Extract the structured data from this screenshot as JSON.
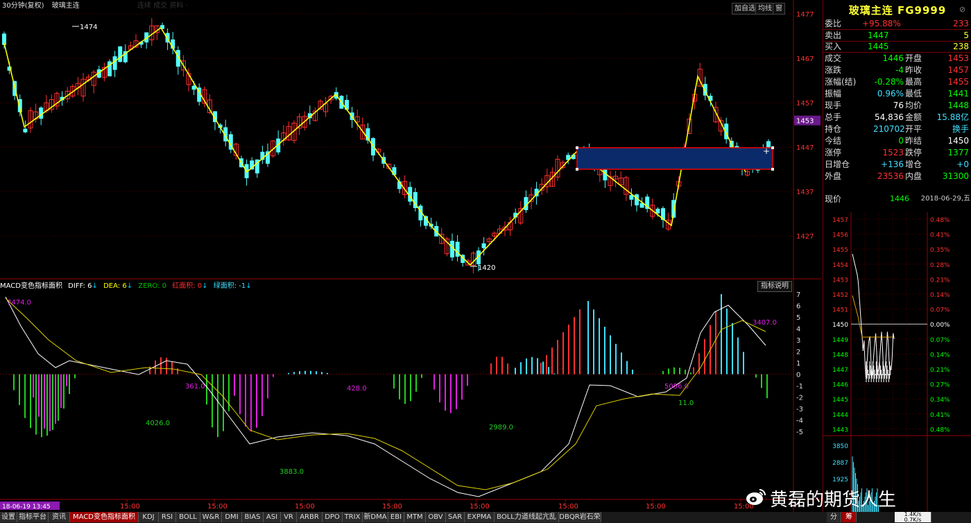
{
  "app": {
    "header_left": "30分钟(复权)",
    "header_name": "玻璃主连",
    "header_faded": "连续 成交 资料 ·"
  },
  "toolbar": {
    "add_watch": "加自选",
    "avg_line": "均线",
    "window": "窗"
  },
  "price_axis": {
    "ticks": [
      "1477",
      "1467",
      "1457",
      "1447",
      "1437",
      "1427"
    ],
    "current_marker": "1453"
  },
  "macd_axis": {
    "ticks": [
      "7",
      "6",
      "5",
      "4",
      "3",
      "2",
      "1",
      "0",
      "-1",
      "-2",
      "-3",
      "-4",
      "-5"
    ]
  },
  "time_axis": {
    "start_label": "18-06-19 13:45",
    "labels": [
      "15:00",
      "15:00",
      "15:00",
      "15:00",
      "15:00",
      "15:00",
      "15:00",
      "15:00"
    ]
  },
  "annotations": {
    "high": "1474",
    "low": "1420"
  },
  "macd": {
    "name": "MACD变色指标面积",
    "diff_label": "DIFF:",
    "diff_value": "6",
    "dea_label": "DEA:",
    "dea_value": "6",
    "zero_label": "ZERO:",
    "zero_value": "0",
    "red_label": "红面积:",
    "red_value": "0",
    "green_label": "绿面积:",
    "green_value": "-1",
    "explain": "指标说明",
    "area_labels": [
      "7474.0",
      "4026.0",
      "361.0",
      "3883.0",
      "428.0",
      "2989.0",
      "5056.0",
      "11.0",
      "3407.0"
    ]
  },
  "quote": {
    "title": "玻璃主连 FG9999",
    "weibi_label": "委比",
    "weibi_pct": "+95.88%",
    "weibi_val": "233",
    "sell_label": "卖出",
    "sell_price": "1447",
    "sell_vol": "5",
    "buy_label": "买入",
    "buy_price": "1445",
    "buy_vol": "238",
    "rows": [
      {
        "l1": "成交",
        "v1": "1446",
        "l2": "开盘",
        "v2": "1453",
        "c1": "#00ff00",
        "c2": "#ff3030"
      },
      {
        "l1": "涨跌",
        "v1": "-4",
        "l2": "昨收",
        "v2": "1457",
        "c1": "#00ff00",
        "c2": "#ff3030"
      },
      {
        "l1": "涨幅(结)",
        "v1": "-0.28%",
        "l2": "最高",
        "v2": "1455",
        "c1": "#00ff00",
        "c2": "#ff3030"
      },
      {
        "l1": "振幅",
        "v1": "0.96%",
        "l2": "最低",
        "v2": "1441",
        "c1": "#40e0ff",
        "c2": "#00ff00"
      },
      {
        "l1": "现手",
        "v1": "76",
        "l2": "均价",
        "v2": "1448",
        "c1": "#ffffff",
        "c2": "#00ff00"
      },
      {
        "l1": "总手",
        "v1": "54,836",
        "l2": "金额",
        "v2": "15.88亿",
        "c1": "#ffffff",
        "c2": "#40e0ff"
      },
      {
        "l1": "持仓",
        "v1": "210702",
        "l2": "开平",
        "v2": "换手",
        "c1": "#40e0ff",
        "c2": "#40e0ff"
      },
      {
        "l1": "今结",
        "v1": "0",
        "l2": "昨结",
        "v2": "1450",
        "c1": "#00ff00",
        "c2": "#ffffff"
      },
      {
        "l1": "涨停",
        "v1": "1523",
        "l2": "跌停",
        "v2": "1377",
        "c1": "#ff3030",
        "c2": "#00ff00"
      },
      {
        "l1": "日增仓",
        "v1": "+136",
        "l2": "增仓",
        "v2": "+0",
        "c1": "#40e0ff",
        "c2": "#40e0ff"
      },
      {
        "l1": "外盘",
        "v1": "23536",
        "l2": "内盘",
        "v2": "31300",
        "c1": "#ff3030",
        "c2": "#00ff00"
      }
    ],
    "now_label": "现价",
    "now_price": "1446",
    "date": "2018-06-29,五"
  },
  "mini_chart": {
    "price_ticks": [
      "1457",
      "1456",
      "1455",
      "1454",
      "1453",
      "1452",
      "1451",
      "1450",
      "1449",
      "1448",
      "1447",
      "1446",
      "1445",
      "1444",
      "1443"
    ],
    "pct_ticks": [
      "0.48%",
      "0.41%",
      "0.35%",
      "0.28%",
      "0.21%",
      "0.14%",
      "0.07%",
      "0.00%",
      "0.07%",
      "0.14%",
      "0.21%",
      "0.27%",
      "0.34%",
      "0.41%",
      "0.48%"
    ],
    "vol_ticks": [
      "3850",
      "2887",
      "1925"
    ]
  },
  "tabs": [
    "设置",
    "指标平台",
    "资讯",
    "MACD变色指标面积",
    "KDJ",
    "RSI",
    "BOLL",
    "W&R",
    "DMI",
    "BIAS",
    "ASI",
    "VR",
    "ARBR",
    "DPO",
    "TRIX",
    "新DMA",
    "EBI",
    "MTM",
    "OBV",
    "SAR",
    "EXPMA",
    "BOLL力道线起亢乱",
    "DBQR岩石荣"
  ],
  "side_tabs": [
    "分",
    "筹"
  ],
  "status": {
    "speed_up": "1.4K/s",
    "speed_down": "0.7K/s"
  },
  "watermark": "黄磊的期货人生",
  "colors": {
    "up": "#ff3030",
    "down": "#54ffff",
    "zigzag": "#ffff00",
    "bg": "#000000"
  }
}
